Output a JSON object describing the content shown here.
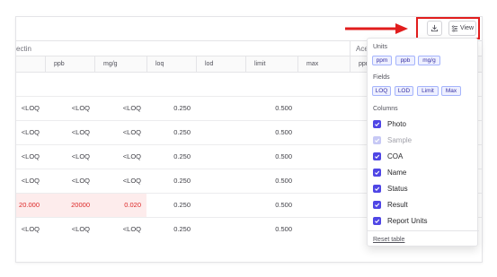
{
  "table": {
    "group_headers": [
      "ectin",
      "Ace"
    ],
    "columns": [
      "ppb",
      "mg/g",
      "loq",
      "lod",
      "limit",
      "max",
      "ppm"
    ],
    "rows": [
      {
        "c0": "<LOQ",
        "c1": "<LOQ",
        "c2": "<LOQ",
        "loq": "0.250",
        "limit": "0.500",
        "flag": false
      },
      {
        "c0": "<LOQ",
        "c1": "<LOQ",
        "c2": "<LOQ",
        "loq": "0.250",
        "limit": "0.500",
        "flag": false
      },
      {
        "c0": "<LOQ",
        "c1": "<LOQ",
        "c2": "<LOQ",
        "loq": "0.250",
        "limit": "0.500",
        "flag": false
      },
      {
        "c0": "<LOQ",
        "c1": "<LOQ",
        "c2": "<LOQ",
        "loq": "0.250",
        "limit": "0.500",
        "flag": false
      },
      {
        "c0": "20.000",
        "c1": "20000",
        "c2": "0.020",
        "loq": "0.250",
        "limit": "0.500",
        "flag": true
      },
      {
        "c0": "<LOQ",
        "c1": "<LOQ",
        "c2": "<LOQ",
        "loq": "0.250",
        "limit": "0.500",
        "flag": false
      }
    ]
  },
  "toolbar": {
    "download_icon": "download-icon",
    "view_icon": "sliders-icon",
    "view_label": "View"
  },
  "view_menu": {
    "units_title": "Units",
    "units": [
      "ppm",
      "ppb",
      "mg/g"
    ],
    "fields_title": "Fields",
    "fields": [
      "LOQ",
      "LOD",
      "Limit",
      "Max"
    ],
    "columns_title": "Columns",
    "columns": [
      {
        "label": "Photo",
        "checked": true,
        "disabled": false
      },
      {
        "label": "Sample",
        "checked": true,
        "disabled": true
      },
      {
        "label": "COA",
        "checked": true,
        "disabled": false
      },
      {
        "label": "Name",
        "checked": true,
        "disabled": false
      },
      {
        "label": "Status",
        "checked": true,
        "disabled": false
      },
      {
        "label": "Result",
        "checked": true,
        "disabled": false
      },
      {
        "label": "Report Units",
        "checked": true,
        "disabled": false
      }
    ],
    "reset_label": "Reset table"
  },
  "colors": {
    "accent": "#4f46e5",
    "highlight_red": "#e11d1d",
    "fail_text": "#dc2626",
    "fail_bg": "#fdecec"
  }
}
